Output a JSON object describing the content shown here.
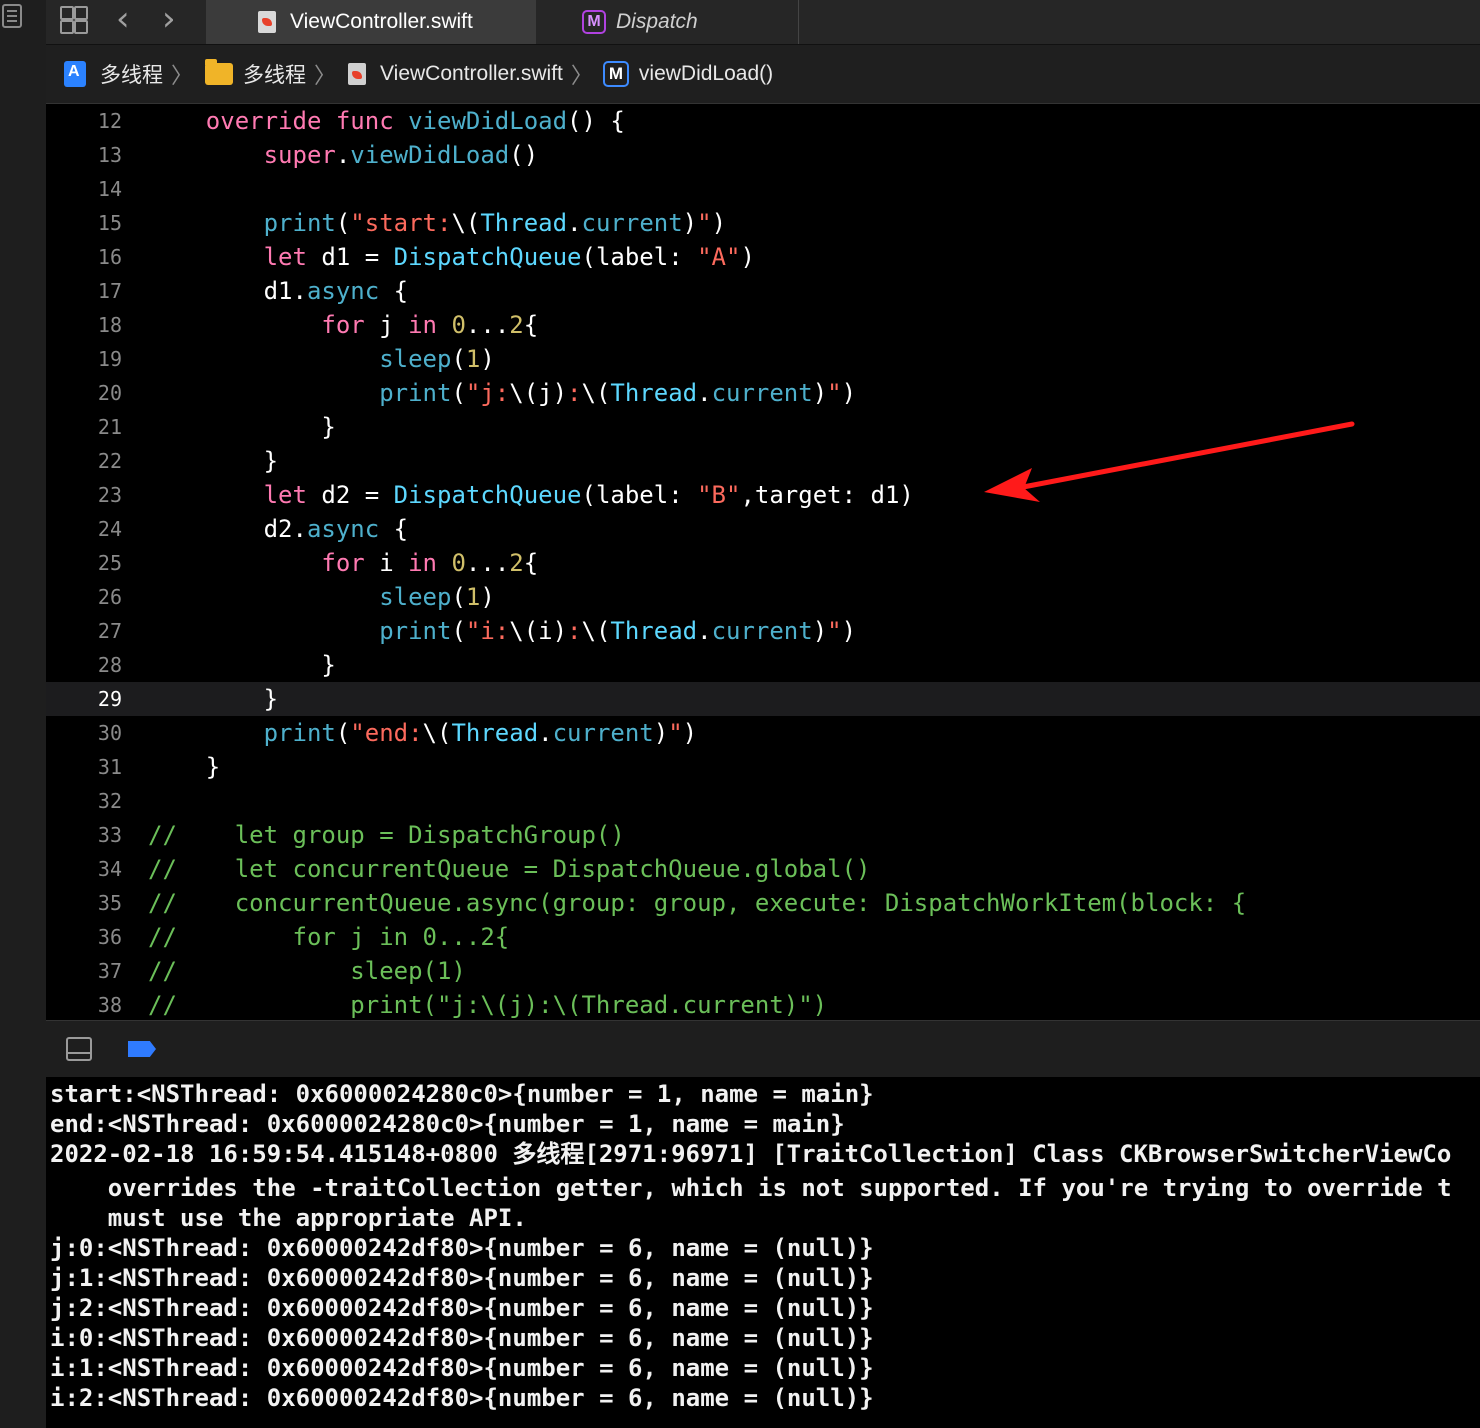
{
  "tabs": [
    {
      "label": "ViewController.swift",
      "icon": "swift-file-icon",
      "active": true
    },
    {
      "label": "Dispatch",
      "icon": "module-icon",
      "active": false
    }
  ],
  "breadcrumb": [
    {
      "label": "多线程",
      "icon": "app-project-icon"
    },
    {
      "label": "多线程",
      "icon": "folder-icon"
    },
    {
      "label": "ViewController.swift",
      "icon": "swift-file-icon"
    },
    {
      "label": "viewDidLoad()",
      "icon": "method-icon",
      "icon_letter": "M"
    }
  ],
  "editor": {
    "current_line": 29,
    "lines": [
      {
        "n": "12",
        "tokens": [
          [
            "pl",
            "    "
          ],
          [
            "kw",
            "override"
          ],
          [
            "pl",
            " "
          ],
          [
            "kw",
            "func"
          ],
          [
            "pl",
            " "
          ],
          [
            "fn",
            "viewDidLoad"
          ],
          [
            "pl",
            "() {"
          ]
        ]
      },
      {
        "n": "13",
        "tokens": [
          [
            "pl",
            "        "
          ],
          [
            "kw",
            "super"
          ],
          [
            "pl",
            "."
          ],
          [
            "fn",
            "viewDidLoad"
          ],
          [
            "pl",
            "()"
          ]
        ]
      },
      {
        "n": "14",
        "tokens": []
      },
      {
        "n": "15",
        "tokens": [
          [
            "pl",
            "        "
          ],
          [
            "fn",
            "print"
          ],
          [
            "pl",
            "("
          ],
          [
            "st",
            "\"start:"
          ],
          [
            "pl",
            "\\("
          ],
          [
            "ty",
            "Thread"
          ],
          [
            "pl",
            "."
          ],
          [
            "fn",
            "current"
          ],
          [
            "pl",
            ")"
          ],
          [
            "st",
            "\""
          ],
          [
            "pl",
            ")"
          ]
        ]
      },
      {
        "n": "16",
        "tokens": [
          [
            "pl",
            "        "
          ],
          [
            "kw",
            "let"
          ],
          [
            "pl",
            " d1 = "
          ],
          [
            "ty",
            "DispatchQueue"
          ],
          [
            "pl",
            "(label: "
          ],
          [
            "st",
            "\"A\""
          ],
          [
            "pl",
            ")"
          ]
        ]
      },
      {
        "n": "17",
        "tokens": [
          [
            "pl",
            "        d1."
          ],
          [
            "fn",
            "async"
          ],
          [
            "pl",
            " {"
          ]
        ]
      },
      {
        "n": "18",
        "tokens": [
          [
            "pl",
            "            "
          ],
          [
            "kw",
            "for"
          ],
          [
            "pl",
            " j "
          ],
          [
            "kw",
            "in"
          ],
          [
            "pl",
            " "
          ],
          [
            "num",
            "0"
          ],
          [
            "pl",
            "..."
          ],
          [
            "num",
            "2"
          ],
          [
            "pl",
            "{"
          ]
        ]
      },
      {
        "n": "19",
        "tokens": [
          [
            "pl",
            "                "
          ],
          [
            "fn",
            "sleep"
          ],
          [
            "pl",
            "("
          ],
          [
            "num",
            "1"
          ],
          [
            "pl",
            ")"
          ]
        ]
      },
      {
        "n": "20",
        "tokens": [
          [
            "pl",
            "                "
          ],
          [
            "fn",
            "print"
          ],
          [
            "pl",
            "("
          ],
          [
            "st",
            "\"j:"
          ],
          [
            "pl",
            "\\(j)"
          ],
          [
            "st",
            ":"
          ],
          [
            "pl",
            "\\("
          ],
          [
            "ty",
            "Thread"
          ],
          [
            "pl",
            "."
          ],
          [
            "fn",
            "current"
          ],
          [
            "pl",
            ")"
          ],
          [
            "st",
            "\""
          ],
          [
            "pl",
            ")"
          ]
        ]
      },
      {
        "n": "21",
        "tokens": [
          [
            "pl",
            "            }"
          ]
        ]
      },
      {
        "n": "22",
        "tokens": [
          [
            "pl",
            "        }"
          ]
        ]
      },
      {
        "n": "23",
        "tokens": [
          [
            "pl",
            "        "
          ],
          [
            "kw",
            "let"
          ],
          [
            "pl",
            " d2 = "
          ],
          [
            "ty",
            "DispatchQueue"
          ],
          [
            "pl",
            "(label: "
          ],
          [
            "st",
            "\"B\""
          ],
          [
            "pl",
            ",target: d1)"
          ]
        ]
      },
      {
        "n": "24",
        "tokens": [
          [
            "pl",
            "        d2."
          ],
          [
            "fn",
            "async"
          ],
          [
            "pl",
            " {"
          ]
        ]
      },
      {
        "n": "25",
        "tokens": [
          [
            "pl",
            "            "
          ],
          [
            "kw",
            "for"
          ],
          [
            "pl",
            " i "
          ],
          [
            "kw",
            "in"
          ],
          [
            "pl",
            " "
          ],
          [
            "num",
            "0"
          ],
          [
            "pl",
            "..."
          ],
          [
            "num",
            "2"
          ],
          [
            "pl",
            "{"
          ]
        ]
      },
      {
        "n": "26",
        "tokens": [
          [
            "pl",
            "                "
          ],
          [
            "fn",
            "sleep"
          ],
          [
            "pl",
            "("
          ],
          [
            "num",
            "1"
          ],
          [
            "pl",
            ")"
          ]
        ]
      },
      {
        "n": "27",
        "tokens": [
          [
            "pl",
            "                "
          ],
          [
            "fn",
            "print"
          ],
          [
            "pl",
            "("
          ],
          [
            "st",
            "\"i:"
          ],
          [
            "pl",
            "\\(i)"
          ],
          [
            "st",
            ":"
          ],
          [
            "pl",
            "\\("
          ],
          [
            "ty",
            "Thread"
          ],
          [
            "pl",
            "."
          ],
          [
            "fn",
            "current"
          ],
          [
            "pl",
            ")"
          ],
          [
            "st",
            "\""
          ],
          [
            "pl",
            ")"
          ]
        ]
      },
      {
        "n": "28",
        "tokens": [
          [
            "pl",
            "            }"
          ]
        ]
      },
      {
        "n": "29",
        "tokens": [
          [
            "pl",
            "        }"
          ]
        ]
      },
      {
        "n": "30",
        "tokens": [
          [
            "pl",
            "        "
          ],
          [
            "fn",
            "print"
          ],
          [
            "pl",
            "("
          ],
          [
            "st",
            "\"end:"
          ],
          [
            "pl",
            "\\("
          ],
          [
            "ty",
            "Thread"
          ],
          [
            "pl",
            "."
          ],
          [
            "fn",
            "current"
          ],
          [
            "pl",
            ")"
          ],
          [
            "st",
            "\""
          ],
          [
            "pl",
            ")"
          ]
        ]
      },
      {
        "n": "31",
        "tokens": [
          [
            "pl",
            "    }"
          ]
        ]
      },
      {
        "n": "32",
        "tokens": []
      },
      {
        "n": "33",
        "tokens": [
          [
            "cm",
            "//    let group = DispatchGroup()"
          ]
        ]
      },
      {
        "n": "34",
        "tokens": [
          [
            "cm",
            "//    let concurrentQueue = DispatchQueue.global()"
          ]
        ]
      },
      {
        "n": "35",
        "tokens": [
          [
            "cm",
            "//    concurrentQueue.async(group: group, execute: DispatchWorkItem(block: {"
          ]
        ]
      },
      {
        "n": "36",
        "tokens": [
          [
            "cm",
            "//        for j in 0...2{"
          ]
        ]
      },
      {
        "n": "37",
        "tokens": [
          [
            "cm",
            "//            sleep(1)"
          ]
        ]
      },
      {
        "n": "38",
        "tokens": [
          [
            "cm",
            "//            print(\"j:\\(j):\\(Thread.current)\")"
          ]
        ]
      }
    ]
  },
  "annotation": {
    "type": "red-arrow",
    "points_to_line": "23",
    "color": "#ff1a1a"
  },
  "debug_bar": {
    "icons": [
      "hide-panel-icon",
      "breakpoint-icon"
    ],
    "breakpoint_color": "#2f7bff"
  },
  "console": {
    "lines": [
      "start:<NSThread: 0x6000024280c0>{number = 1, name = main}",
      "end:<NSThread: 0x6000024280c0>{number = 1, name = main}",
      "2022-02-18 16:59:54.415148+0800 多线程[2971:96971] [TraitCollection] Class CKBrowserSwitcherViewCo",
      "    overrides the -traitCollection getter, which is not supported. If you're trying to override t",
      "    must use the appropriate API.",
      "j:0:<NSThread: 0x60000242df80>{number = 6, name = (null)}",
      "j:1:<NSThread: 0x60000242df80>{number = 6, name = (null)}",
      "j:2:<NSThread: 0x60000242df80>{number = 6, name = (null)}",
      "i:0:<NSThread: 0x60000242df80>{number = 6, name = (null)}",
      "i:1:<NSThread: 0x60000242df80>{number = 6, name = (null)}",
      "i:2:<NSThread: 0x60000242df80>{number = 6, name = (null)}"
    ]
  }
}
